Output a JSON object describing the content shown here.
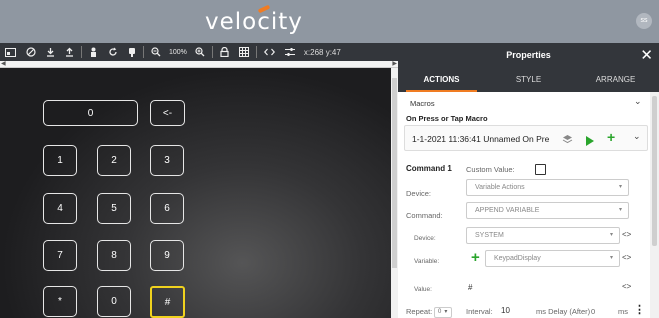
{
  "header": {
    "logo_text": "velocity",
    "avatar_initials": "ss",
    "accent_color": "#f07c22"
  },
  "toolbar": {
    "zoom_level": "100%",
    "coordinates": "x:268 y:47"
  },
  "keypad": {
    "display_value": "0",
    "backspace_label": "<-",
    "keys": [
      "1",
      "2",
      "3",
      "4",
      "5",
      "6",
      "7",
      "8",
      "9",
      "*",
      "0",
      "#"
    ],
    "selected_key": "#",
    "selection_color": "#f0d21e"
  },
  "properties": {
    "title": "Properties",
    "close_glyph": "✕",
    "tabs": [
      "ACTIONS",
      "STYLE",
      "ARRANGE"
    ],
    "active_tab": "ACTIONS",
    "macros_label": "Macros",
    "on_press_label": "On Press or Tap Macro",
    "macro_name": "1-1-2021 11:36:41 Unnamed On Pre",
    "command": {
      "title": "Command 1",
      "custom_value_label": "Custom Value:",
      "custom_value_checked": false,
      "device_label": "Device:",
      "device_value": "Variable Actions",
      "command_label": "Command:",
      "command_value": "APPEND VARIABLE",
      "sub_device_label": "Device:",
      "sub_device_value": "SYSTEM",
      "variable_label": "Variable:",
      "variable_value": "KeypadDisplay",
      "value_label": "Value:",
      "value_value": "#",
      "repeat_label": "Repeat:",
      "repeat_value": "0",
      "interval_label": "Interval:",
      "interval_value": "10",
      "delay_label": "ms Delay (After)",
      "delay_value": "0",
      "ms_label": "ms"
    }
  }
}
